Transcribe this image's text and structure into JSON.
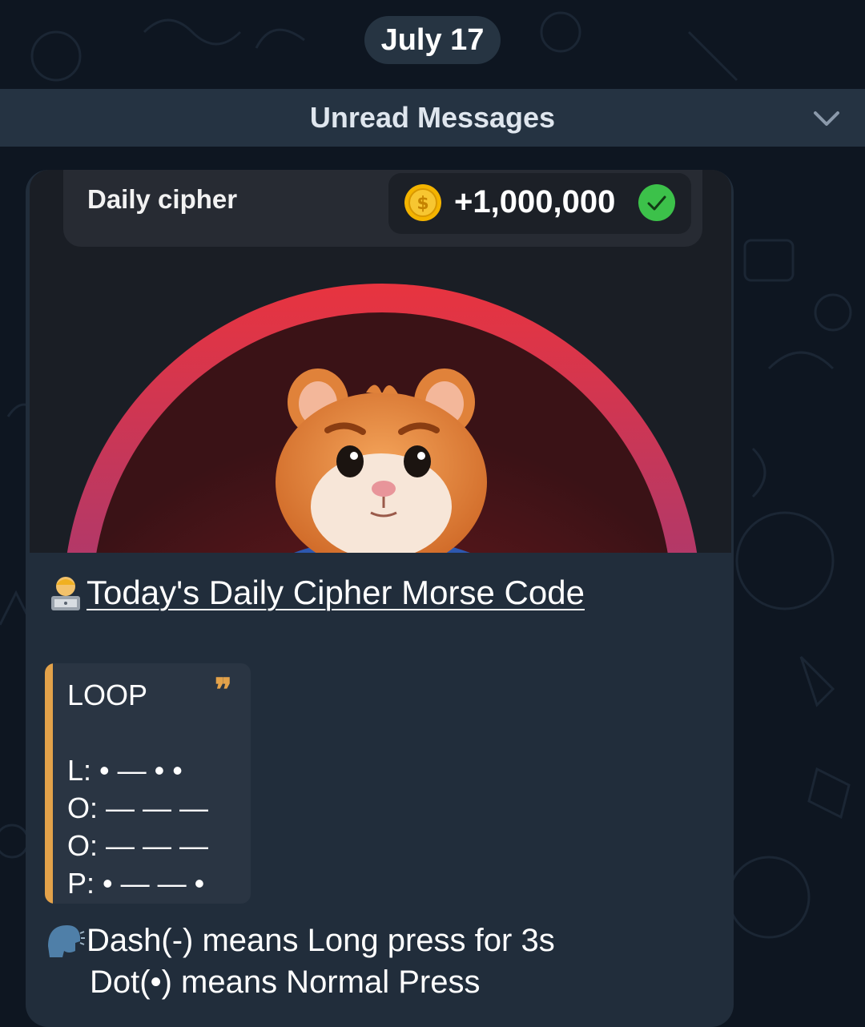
{
  "date_divider": {
    "label": "July 17"
  },
  "unread": {
    "label": "Unread Messages",
    "icon": "chevron-down-icon"
  },
  "message": {
    "media": {
      "cipher_title": "Daily cipher",
      "reward_amount": "+1,000,000",
      "coin_icon": "coin-icon",
      "status_icon": "check-icon",
      "image": "hamster-character",
      "colors": {
        "arc_top": "#e8343f",
        "arc_bottom": "#6a3fa0",
        "coin": "#f4b400",
        "check": "#3cc14a"
      }
    },
    "headline": {
      "emoji": "technologist-icon",
      "text": "Today's Daily Cipher Morse Code"
    },
    "quote": {
      "word": "LOOP",
      "lines": [
        "L: • — • •",
        "O: — — —",
        "O: — — —",
        "P: • — — •"
      ],
      "accent": "#e3a24a"
    },
    "note": {
      "emoji": "speaking-head-icon",
      "line1": "Dash(-) means Long press for 3s",
      "line2": "Dot(•) means Normal Press"
    }
  }
}
